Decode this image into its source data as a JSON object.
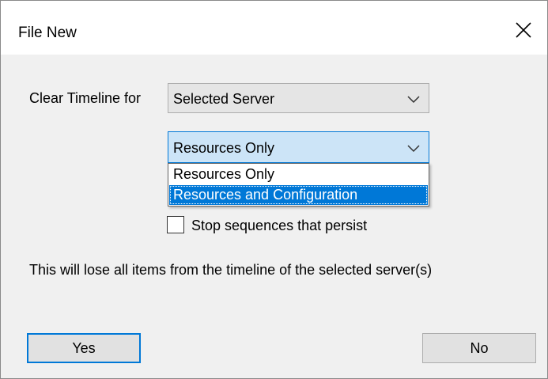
{
  "window": {
    "title": "File New",
    "close_label": "close"
  },
  "clear_timeline": {
    "label": "Clear Timeline for",
    "selected": "Selected Server"
  },
  "scope_combo": {
    "selected": "Resources Only",
    "options": [
      "Resources Only",
      "Resources and Configuration"
    ],
    "highlighted_index": 1
  },
  "stop_sequences": {
    "label": "Stop sequences that persist",
    "checked": false
  },
  "warning": {
    "text": "This will lose all items from the timeline of the selected server(s)"
  },
  "buttons": {
    "yes": "Yes",
    "no": "No"
  },
  "colors": {
    "accent": "#0078d7",
    "highlight_text": "#ffffff",
    "combo_focus_bg": "#cce4f7"
  },
  "icons": {
    "close": "close-icon",
    "chevron": "chevron-down-icon"
  }
}
